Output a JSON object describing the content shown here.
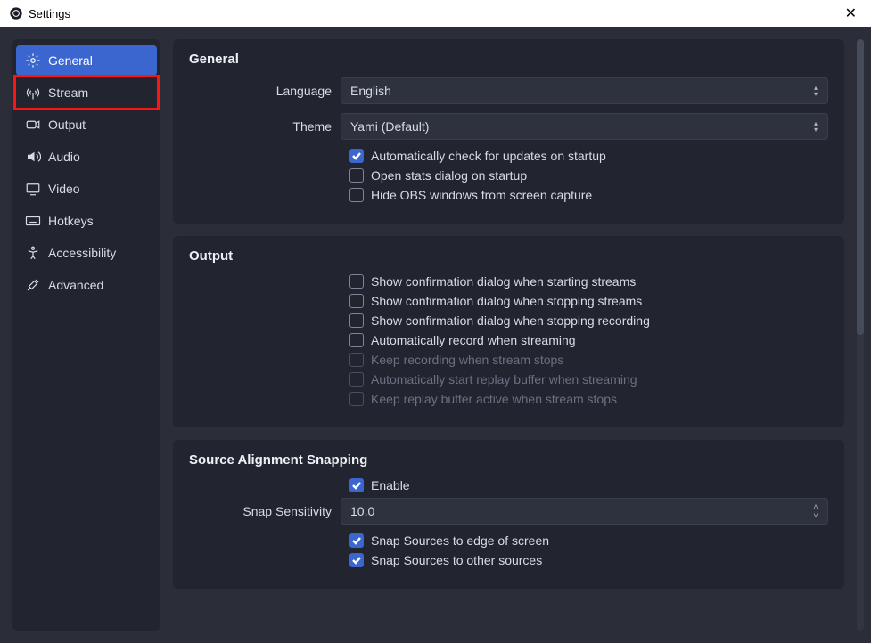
{
  "titlebar": {
    "title": "Settings"
  },
  "sidebar": {
    "items": [
      {
        "label": "General",
        "icon": "gear",
        "active": true
      },
      {
        "label": "Stream",
        "icon": "antenna",
        "active": false,
        "highlight": true
      },
      {
        "label": "Output",
        "icon": "camera",
        "active": false
      },
      {
        "label": "Audio",
        "icon": "speaker",
        "active": false
      },
      {
        "label": "Video",
        "icon": "monitor",
        "active": false
      },
      {
        "label": "Hotkeys",
        "icon": "keyboard",
        "active": false
      },
      {
        "label": "Accessibility",
        "icon": "accessibility",
        "active": false
      },
      {
        "label": "Advanced",
        "icon": "tools",
        "active": false
      }
    ]
  },
  "general": {
    "title": "General",
    "language_label": "Language",
    "language_value": "English",
    "theme_label": "Theme",
    "theme_value": "Yami (Default)",
    "checks": [
      {
        "label": "Automatically check for updates on startup",
        "checked": true,
        "disabled": false
      },
      {
        "label": "Open stats dialog on startup",
        "checked": false,
        "disabled": false
      },
      {
        "label": "Hide OBS windows from screen capture",
        "checked": false,
        "disabled": false
      }
    ]
  },
  "output": {
    "title": "Output",
    "checks": [
      {
        "label": "Show confirmation dialog when starting streams",
        "checked": false,
        "disabled": false
      },
      {
        "label": "Show confirmation dialog when stopping streams",
        "checked": false,
        "disabled": false
      },
      {
        "label": "Show confirmation dialog when stopping recording",
        "checked": false,
        "disabled": false
      },
      {
        "label": "Automatically record when streaming",
        "checked": false,
        "disabled": false
      },
      {
        "label": "Keep recording when stream stops",
        "checked": false,
        "disabled": true
      },
      {
        "label": "Automatically start replay buffer when streaming",
        "checked": false,
        "disabled": true
      },
      {
        "label": "Keep replay buffer active when stream stops",
        "checked": false,
        "disabled": true
      }
    ]
  },
  "snapping": {
    "title": "Source Alignment Snapping",
    "enable": {
      "label": "Enable",
      "checked": true
    },
    "sensitivity_label": "Snap Sensitivity",
    "sensitivity_value": "10.0",
    "checks": [
      {
        "label": "Snap Sources to edge of screen",
        "checked": true
      },
      {
        "label": "Snap Sources to other sources",
        "checked": true
      }
    ]
  }
}
